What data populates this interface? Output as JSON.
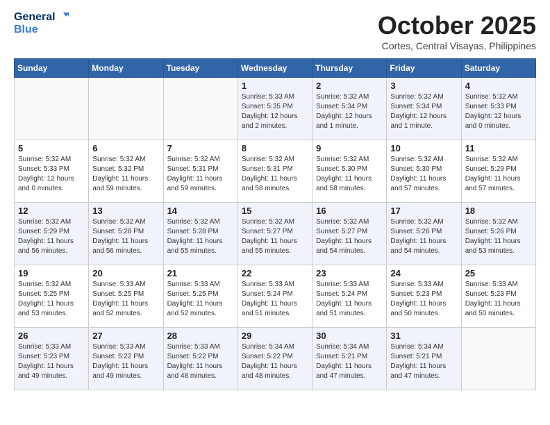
{
  "header": {
    "logo_general": "General",
    "logo_blue": "Blue",
    "month_title": "October 2025",
    "location": "Cortes, Central Visayas, Philippines"
  },
  "days_of_week": [
    "Sunday",
    "Monday",
    "Tuesday",
    "Wednesday",
    "Thursday",
    "Friday",
    "Saturday"
  ],
  "weeks": [
    [
      {
        "num": "",
        "info": ""
      },
      {
        "num": "",
        "info": ""
      },
      {
        "num": "",
        "info": ""
      },
      {
        "num": "1",
        "info": "Sunrise: 5:33 AM\nSunset: 5:35 PM\nDaylight: 12 hours\nand 2 minutes."
      },
      {
        "num": "2",
        "info": "Sunrise: 5:32 AM\nSunset: 5:34 PM\nDaylight: 12 hours\nand 1 minute."
      },
      {
        "num": "3",
        "info": "Sunrise: 5:32 AM\nSunset: 5:34 PM\nDaylight: 12 hours\nand 1 minute."
      },
      {
        "num": "4",
        "info": "Sunrise: 5:32 AM\nSunset: 5:33 PM\nDaylight: 12 hours\nand 0 minutes."
      }
    ],
    [
      {
        "num": "5",
        "info": "Sunrise: 5:32 AM\nSunset: 5:33 PM\nDaylight: 12 hours\nand 0 minutes."
      },
      {
        "num": "6",
        "info": "Sunrise: 5:32 AM\nSunset: 5:32 PM\nDaylight: 11 hours\nand 59 minutes."
      },
      {
        "num": "7",
        "info": "Sunrise: 5:32 AM\nSunset: 5:31 PM\nDaylight: 11 hours\nand 59 minutes."
      },
      {
        "num": "8",
        "info": "Sunrise: 5:32 AM\nSunset: 5:31 PM\nDaylight: 11 hours\nand 58 minutes."
      },
      {
        "num": "9",
        "info": "Sunrise: 5:32 AM\nSunset: 5:30 PM\nDaylight: 11 hours\nand 58 minutes."
      },
      {
        "num": "10",
        "info": "Sunrise: 5:32 AM\nSunset: 5:30 PM\nDaylight: 11 hours\nand 57 minutes."
      },
      {
        "num": "11",
        "info": "Sunrise: 5:32 AM\nSunset: 5:29 PM\nDaylight: 11 hours\nand 57 minutes."
      }
    ],
    [
      {
        "num": "12",
        "info": "Sunrise: 5:32 AM\nSunset: 5:29 PM\nDaylight: 11 hours\nand 56 minutes."
      },
      {
        "num": "13",
        "info": "Sunrise: 5:32 AM\nSunset: 5:28 PM\nDaylight: 11 hours\nand 56 minutes."
      },
      {
        "num": "14",
        "info": "Sunrise: 5:32 AM\nSunset: 5:28 PM\nDaylight: 11 hours\nand 55 minutes."
      },
      {
        "num": "15",
        "info": "Sunrise: 5:32 AM\nSunset: 5:27 PM\nDaylight: 11 hours\nand 55 minutes."
      },
      {
        "num": "16",
        "info": "Sunrise: 5:32 AM\nSunset: 5:27 PM\nDaylight: 11 hours\nand 54 minutes."
      },
      {
        "num": "17",
        "info": "Sunrise: 5:32 AM\nSunset: 5:26 PM\nDaylight: 11 hours\nand 54 minutes."
      },
      {
        "num": "18",
        "info": "Sunrise: 5:32 AM\nSunset: 5:26 PM\nDaylight: 11 hours\nand 53 minutes."
      }
    ],
    [
      {
        "num": "19",
        "info": "Sunrise: 5:32 AM\nSunset: 5:25 PM\nDaylight: 11 hours\nand 53 minutes."
      },
      {
        "num": "20",
        "info": "Sunrise: 5:33 AM\nSunset: 5:25 PM\nDaylight: 11 hours\nand 52 minutes."
      },
      {
        "num": "21",
        "info": "Sunrise: 5:33 AM\nSunset: 5:25 PM\nDaylight: 11 hours\nand 52 minutes."
      },
      {
        "num": "22",
        "info": "Sunrise: 5:33 AM\nSunset: 5:24 PM\nDaylight: 11 hours\nand 51 minutes."
      },
      {
        "num": "23",
        "info": "Sunrise: 5:33 AM\nSunset: 5:24 PM\nDaylight: 11 hours\nand 51 minutes."
      },
      {
        "num": "24",
        "info": "Sunrise: 5:33 AM\nSunset: 5:23 PM\nDaylight: 11 hours\nand 50 minutes."
      },
      {
        "num": "25",
        "info": "Sunrise: 5:33 AM\nSunset: 5:23 PM\nDaylight: 11 hours\nand 50 minutes."
      }
    ],
    [
      {
        "num": "26",
        "info": "Sunrise: 5:33 AM\nSunset: 5:23 PM\nDaylight: 11 hours\nand 49 minutes."
      },
      {
        "num": "27",
        "info": "Sunrise: 5:33 AM\nSunset: 5:22 PM\nDaylight: 11 hours\nand 49 minutes."
      },
      {
        "num": "28",
        "info": "Sunrise: 5:33 AM\nSunset: 5:22 PM\nDaylight: 11 hours\nand 48 minutes."
      },
      {
        "num": "29",
        "info": "Sunrise: 5:34 AM\nSunset: 5:22 PM\nDaylight: 11 hours\nand 48 minutes."
      },
      {
        "num": "30",
        "info": "Sunrise: 5:34 AM\nSunset: 5:21 PM\nDaylight: 11 hours\nand 47 minutes."
      },
      {
        "num": "31",
        "info": "Sunrise: 5:34 AM\nSunset: 5:21 PM\nDaylight: 11 hours\nand 47 minutes."
      },
      {
        "num": "",
        "info": ""
      }
    ]
  ]
}
